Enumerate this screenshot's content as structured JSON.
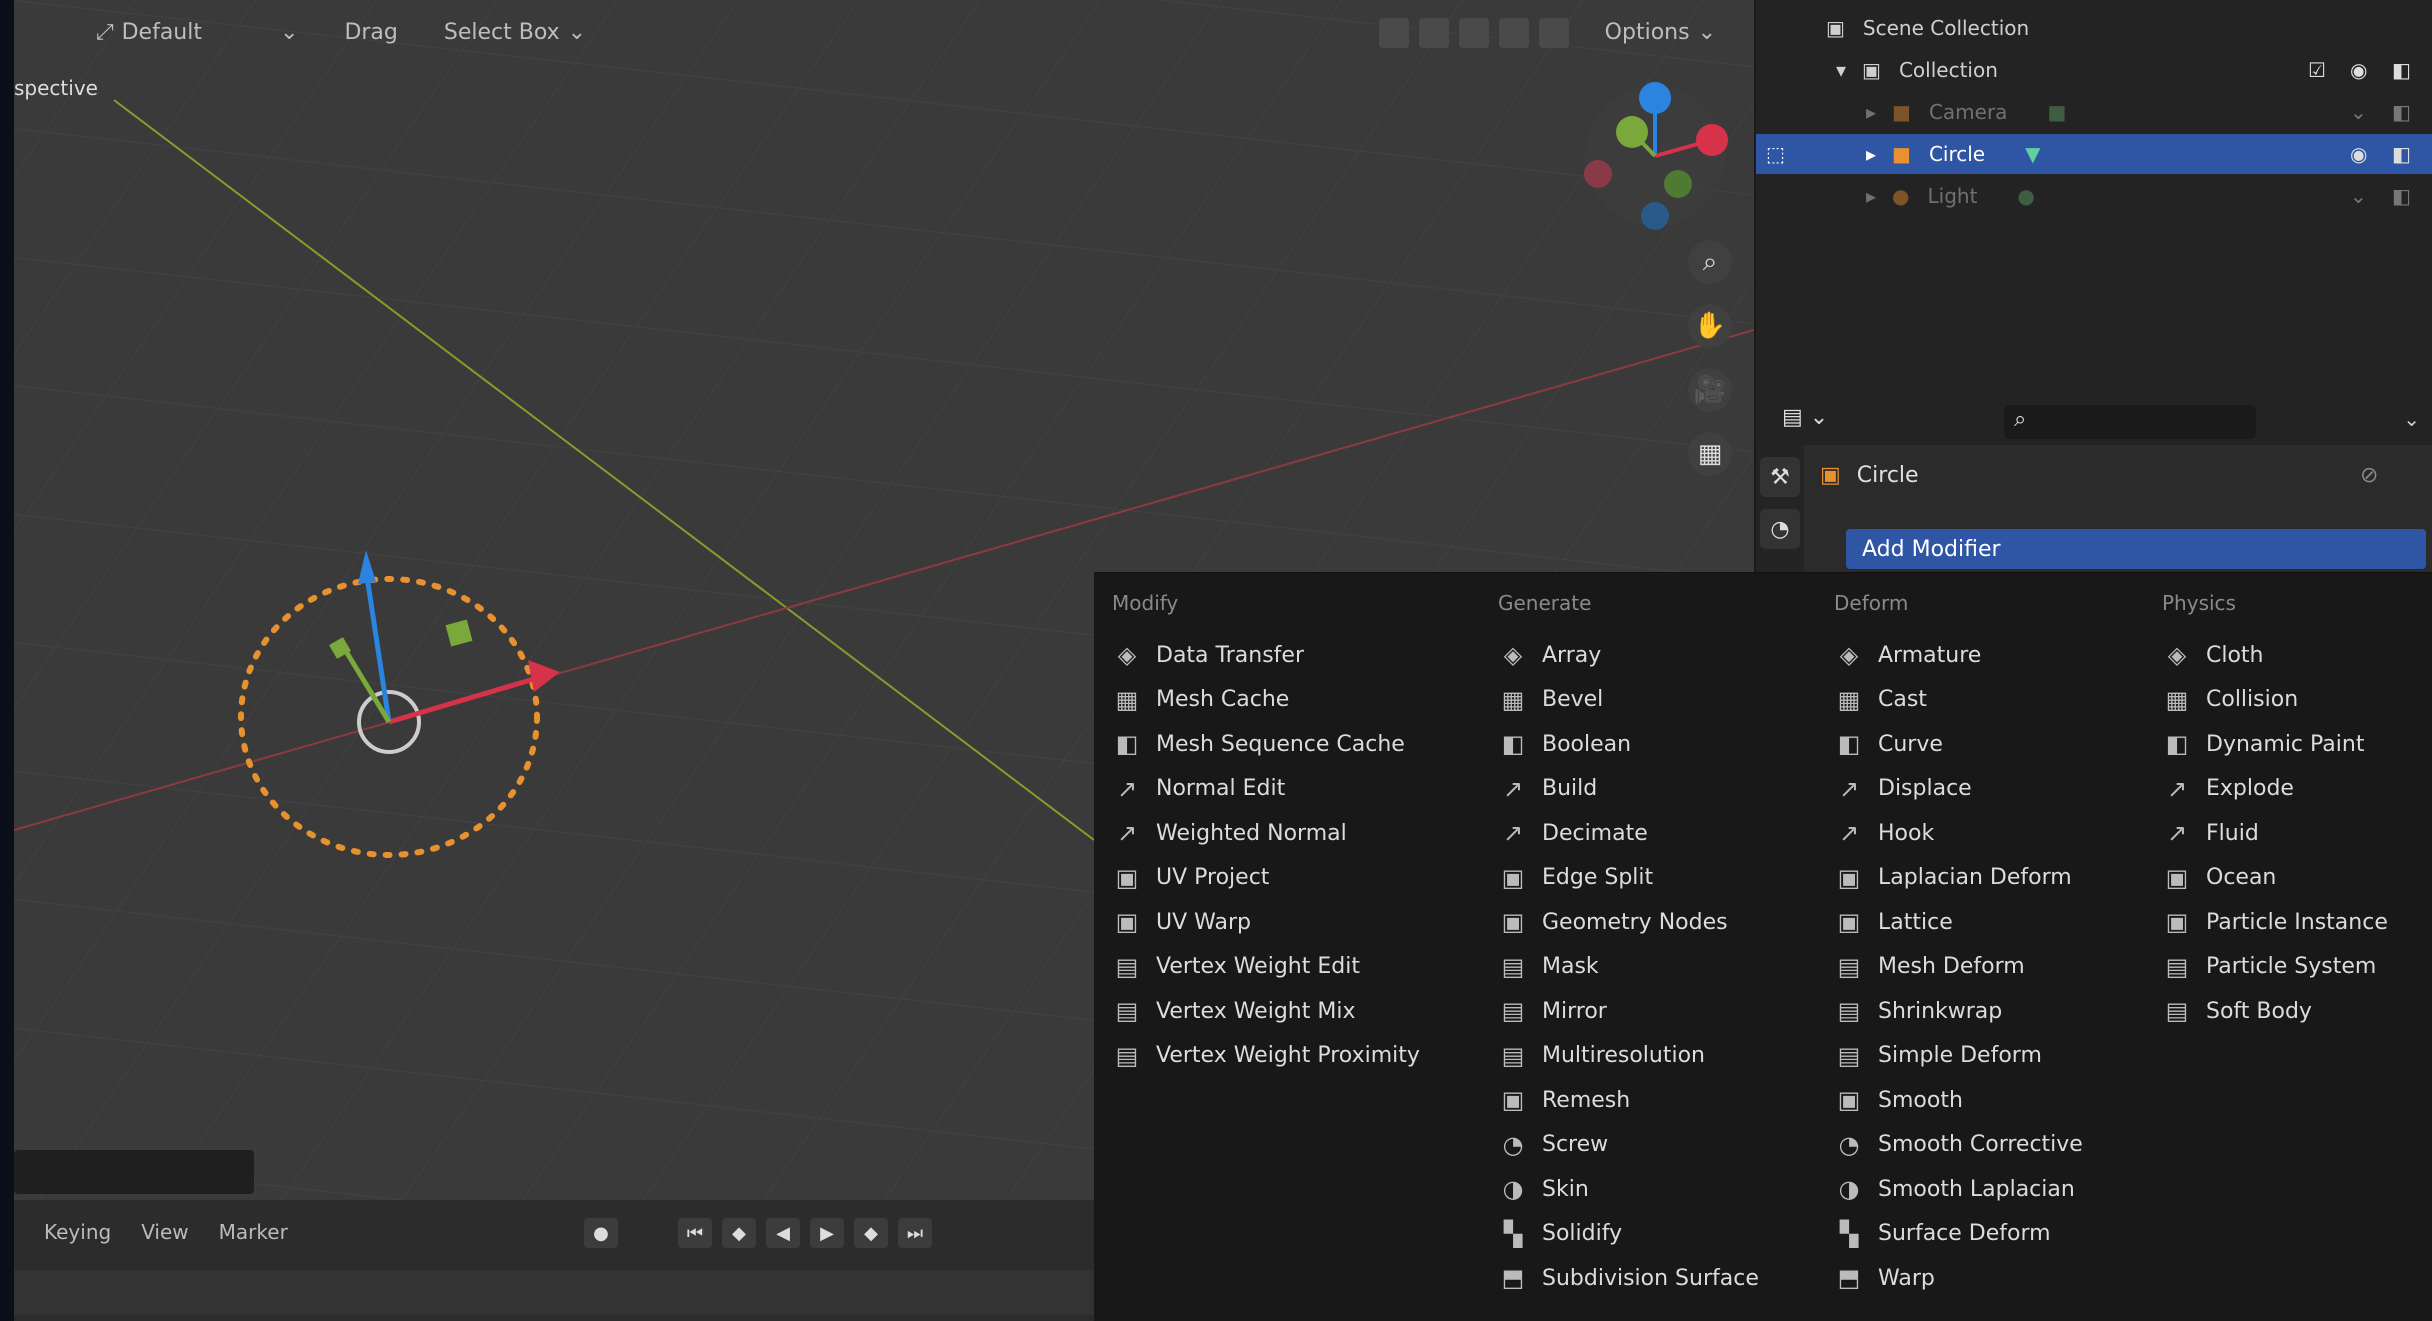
{
  "header": {
    "orientation": "Default",
    "drag_label": "Drag",
    "select_mode": "Select Box",
    "options_label": "Options"
  },
  "viewport": {
    "view_label": "spective"
  },
  "timeline": {
    "keying": "Keying",
    "view": "View",
    "marker": "Marker"
  },
  "outliner": {
    "rows": [
      {
        "label": "Scene Collection"
      },
      {
        "label": "Collection"
      },
      {
        "label": "Camera"
      },
      {
        "label": "Circle"
      },
      {
        "label": "Light"
      }
    ]
  },
  "properties": {
    "object_name": "Circle",
    "add_modifier": "Add Modifier",
    "search_placeholder": ""
  },
  "menu": {
    "columns": [
      {
        "title": "Modify",
        "items": [
          {
            "label": "Data Transfer",
            "icon": "data-transfer-icon"
          },
          {
            "label": "Mesh Cache",
            "icon": "mesh-cache-icon"
          },
          {
            "label": "Mesh Sequence Cache",
            "icon": "mesh-sequence-cache-icon"
          },
          {
            "label": "Normal Edit",
            "icon": "normal-edit-icon"
          },
          {
            "label": "Weighted Normal",
            "icon": "weighted-normal-icon"
          },
          {
            "label": "UV Project",
            "icon": "uv-project-icon"
          },
          {
            "label": "UV Warp",
            "icon": "uv-warp-icon"
          },
          {
            "label": "Vertex Weight Edit",
            "icon": "vertex-weight-icon"
          },
          {
            "label": "Vertex Weight Mix",
            "icon": "vertex-weight-icon"
          },
          {
            "label": "Vertex Weight Proximity",
            "icon": "vertex-weight-icon"
          }
        ]
      },
      {
        "title": "Generate",
        "items": [
          {
            "label": "Array",
            "icon": "array-icon"
          },
          {
            "label": "Bevel",
            "icon": "bevel-icon"
          },
          {
            "label": "Boolean",
            "icon": "boolean-icon"
          },
          {
            "label": "Build",
            "icon": "build-icon"
          },
          {
            "label": "Decimate",
            "icon": "decimate-icon"
          },
          {
            "label": "Edge Split",
            "icon": "edge-split-icon"
          },
          {
            "label": "Geometry Nodes",
            "icon": "geometry-nodes-icon"
          },
          {
            "label": "Mask",
            "icon": "mask-icon"
          },
          {
            "label": "Mirror",
            "icon": "mirror-icon"
          },
          {
            "label": "Multiresolution",
            "icon": "multiresolution-icon"
          },
          {
            "label": "Remesh",
            "icon": "remesh-icon"
          },
          {
            "label": "Screw",
            "icon": "screw-icon"
          },
          {
            "label": "Skin",
            "icon": "skin-icon"
          },
          {
            "label": "Solidify",
            "icon": "solidify-icon"
          },
          {
            "label": "Subdivision Surface",
            "icon": "subdivision-icon"
          }
        ]
      },
      {
        "title": "Deform",
        "items": [
          {
            "label": "Armature",
            "icon": "armature-icon"
          },
          {
            "label": "Cast",
            "icon": "cast-icon"
          },
          {
            "label": "Curve",
            "icon": "curve-icon"
          },
          {
            "label": "Displace",
            "icon": "displace-icon"
          },
          {
            "label": "Hook",
            "icon": "hook-icon"
          },
          {
            "label": "Laplacian Deform",
            "icon": "laplacian-icon"
          },
          {
            "label": "Lattice",
            "icon": "lattice-icon"
          },
          {
            "label": "Mesh Deform",
            "icon": "mesh-deform-icon"
          },
          {
            "label": "Shrinkwrap",
            "icon": "shrinkwrap-icon"
          },
          {
            "label": "Simple Deform",
            "icon": "simple-deform-icon"
          },
          {
            "label": "Smooth",
            "icon": "smooth-icon"
          },
          {
            "label": "Smooth Corrective",
            "icon": "smooth-icon"
          },
          {
            "label": "Smooth Laplacian",
            "icon": "smooth-icon"
          },
          {
            "label": "Surface Deform",
            "icon": "surface-deform-icon"
          },
          {
            "label": "Warp",
            "icon": "warp-icon"
          }
        ]
      },
      {
        "title": "Physics",
        "items": [
          {
            "label": "Cloth",
            "icon": "cloth-icon"
          },
          {
            "label": "Collision",
            "icon": "collision-icon"
          },
          {
            "label": "Dynamic Paint",
            "icon": "dynamic-paint-icon"
          },
          {
            "label": "Explode",
            "icon": "explode-icon"
          },
          {
            "label": "Fluid",
            "icon": "fluid-icon"
          },
          {
            "label": "Ocean",
            "icon": "ocean-icon"
          },
          {
            "label": "Particle Instance",
            "icon": "particle-icon"
          },
          {
            "label": "Particle System",
            "icon": "particle-icon"
          },
          {
            "label": "Soft Body",
            "icon": "soft-body-icon"
          }
        ]
      }
    ]
  },
  "colors": {
    "accent": "#2f56a5",
    "selection_orange": "#e8912f",
    "axis_x": "#d6324a",
    "axis_y": "#7aa83a",
    "axis_z": "#2b84e0"
  }
}
